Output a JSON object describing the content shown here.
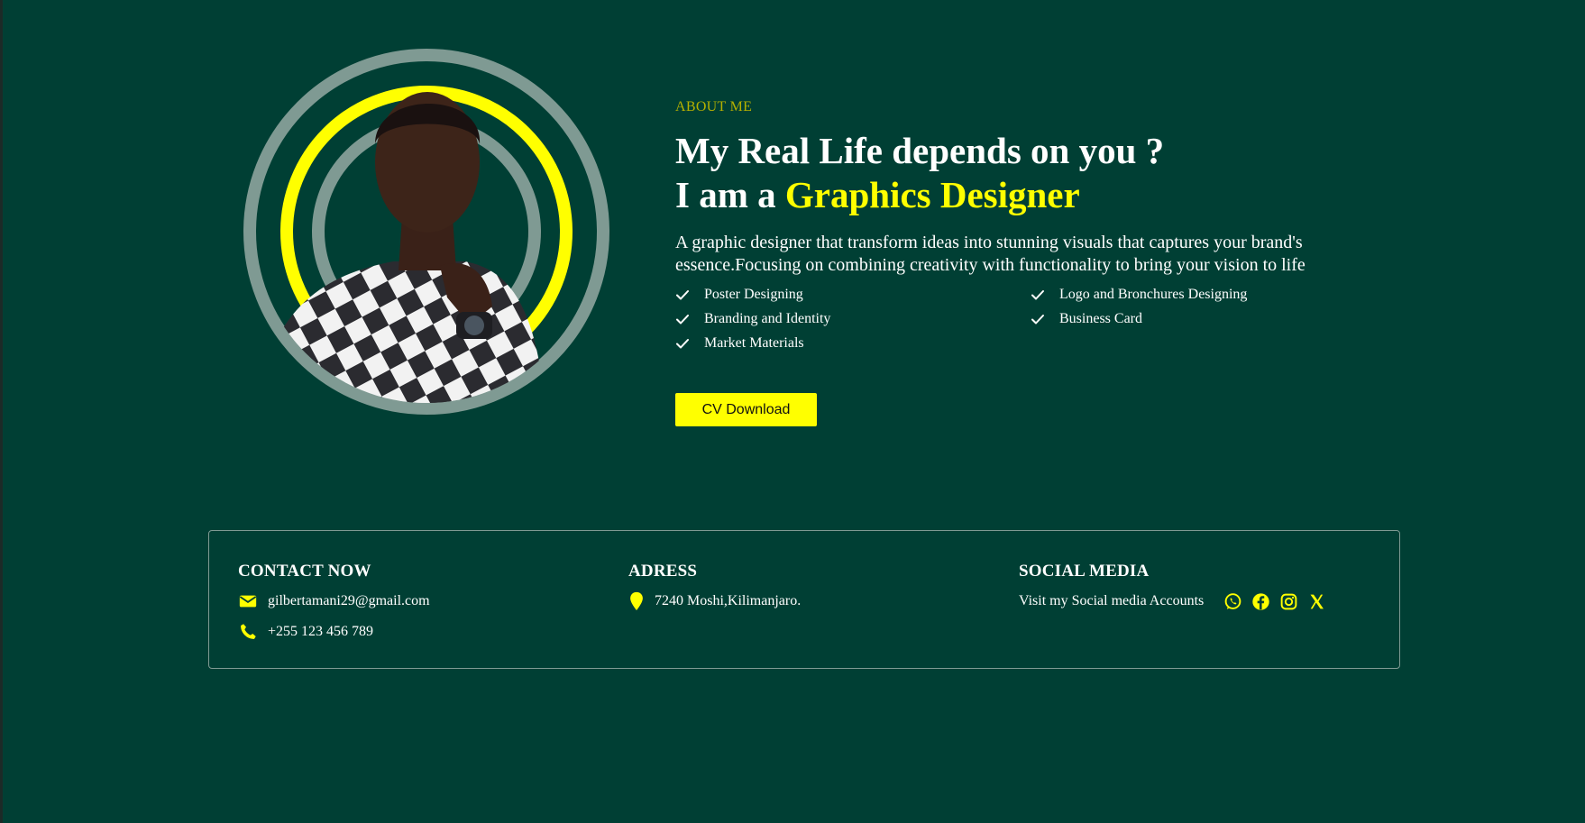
{
  "about": {
    "eyebrow": "ABOUT ME",
    "headline_line1": "My Real Life depends on you ?",
    "headline_prefix": "I am a ",
    "headline_accent": "Graphics Designer",
    "intro": "A graphic designer that transform ideas into stunning visuals that captures your brand's essence.Focusing on combining creativity with functionality to bring your vision to life",
    "skills": [
      "Poster Designing",
      "Logo and Bronchures Designing",
      "Branding and Identity",
      "Business Card",
      "Market Materials"
    ],
    "cv_button": "CV Download"
  },
  "contact": {
    "heading": "CONTACT NOW",
    "email": "gilbertamani29@gmail.com",
    "phone": "+255 123 456 789"
  },
  "address": {
    "heading": "ADRESS",
    "text": "7240 Moshi,Kilimanjaro."
  },
  "social": {
    "heading": "SOCIAL MEDIA",
    "text": "Visit my Social media Accounts",
    "icons": [
      "whatsapp-icon",
      "facebook-icon",
      "instagram-icon",
      "x-icon"
    ]
  },
  "colors": {
    "background": "#003f34",
    "accent": "#ffff00",
    "ring": "#7f9a93"
  }
}
